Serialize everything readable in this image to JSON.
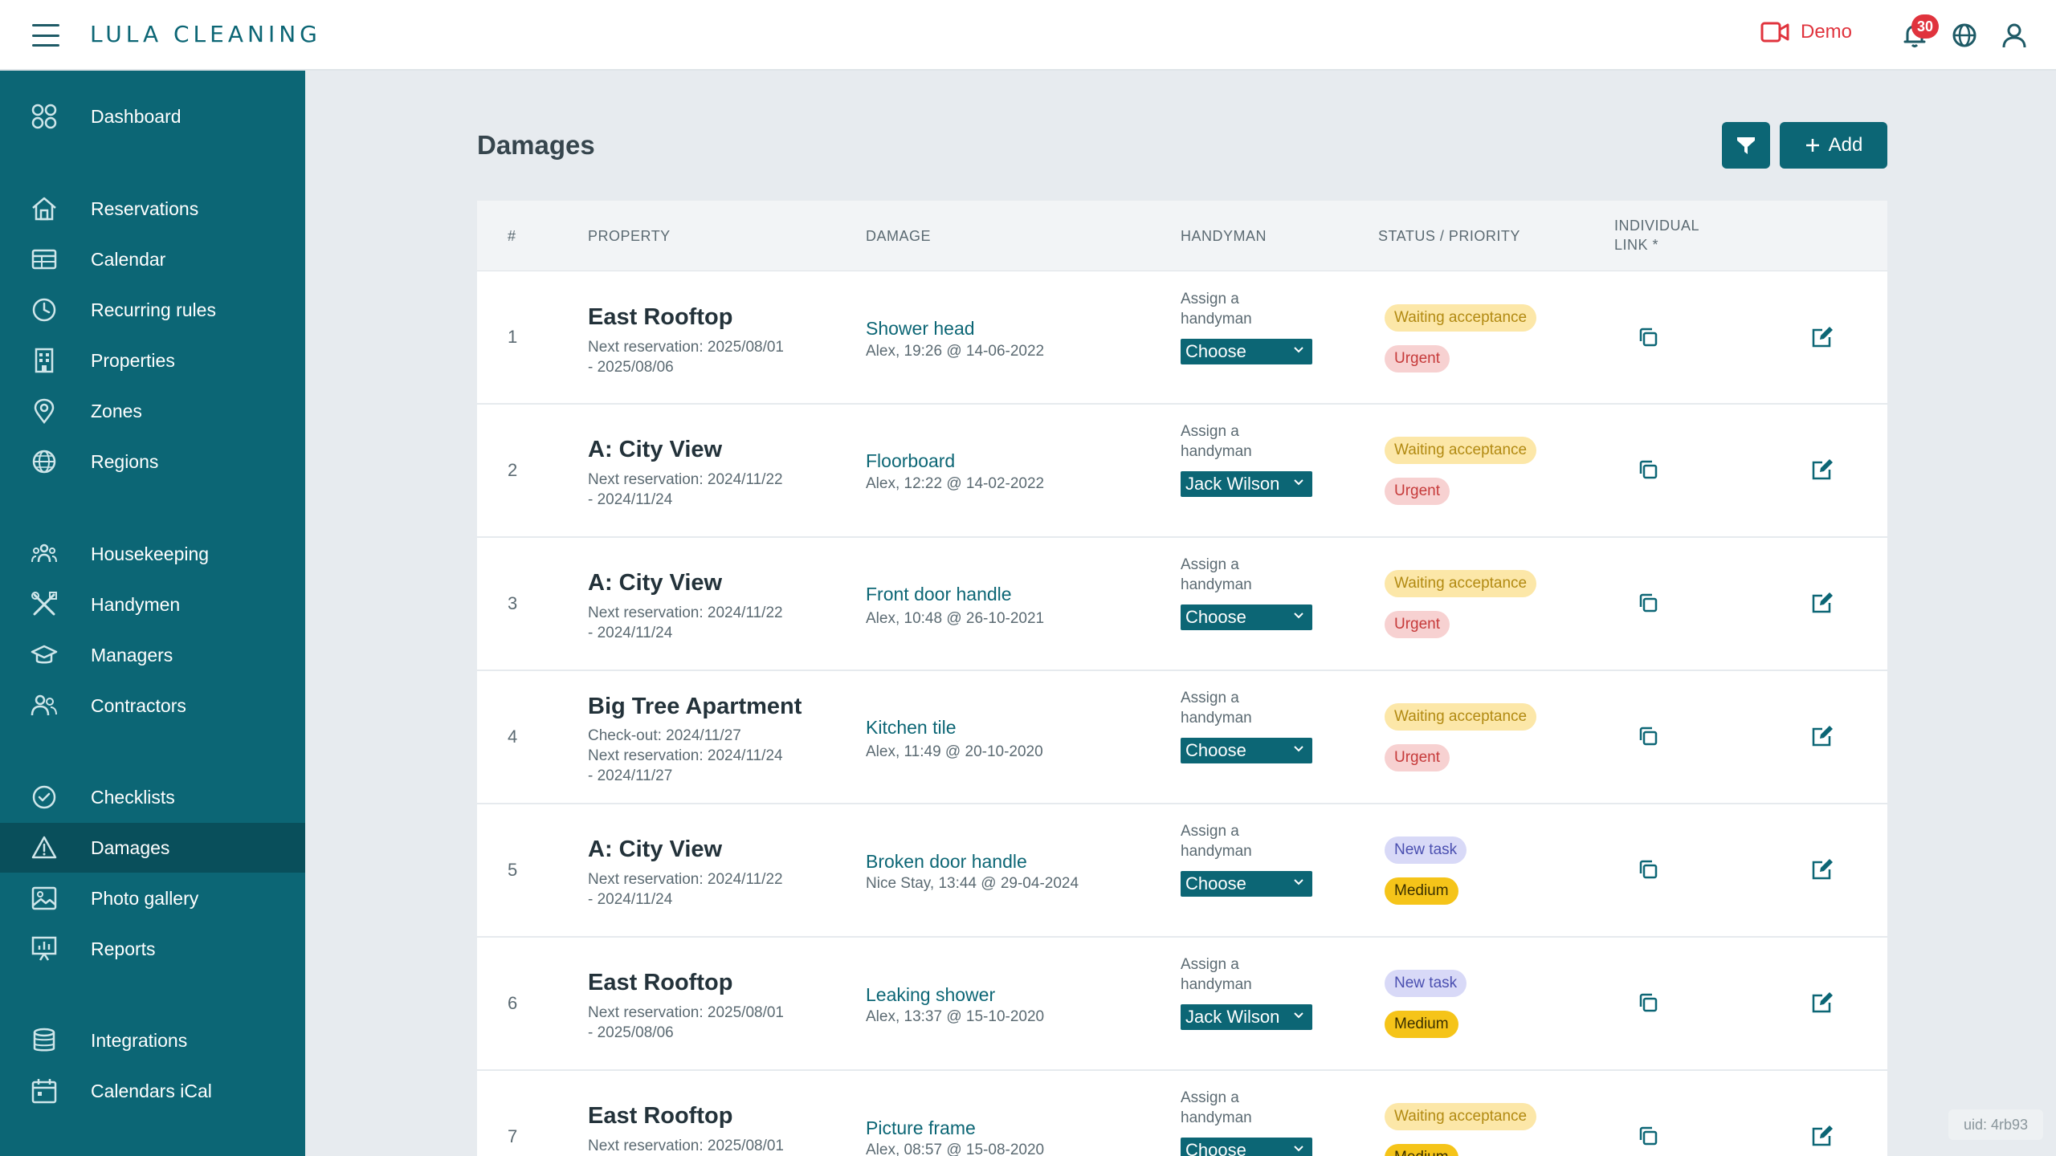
{
  "app": {
    "logo": "LULA CLEANING",
    "demo_label": "Demo",
    "notifications_count": "30",
    "uid": "uid: 4rb93"
  },
  "sidebar": {
    "items": [
      {
        "label": "Dashboard",
        "icon": "grid-icon"
      },
      {
        "label": "Reservations",
        "icon": "home-icon"
      },
      {
        "label": "Calendar",
        "icon": "calendar-table-icon"
      },
      {
        "label": "Recurring rules",
        "icon": "clock-icon"
      },
      {
        "label": "Properties",
        "icon": "building-icon"
      },
      {
        "label": "Zones",
        "icon": "map-pin-icon"
      },
      {
        "label": "Regions",
        "icon": "globe-icon"
      },
      {
        "label": "Housekeeping",
        "icon": "people-group-icon"
      },
      {
        "label": "Handymen",
        "icon": "tools-icon"
      },
      {
        "label": "Managers",
        "icon": "graduation-cap-icon"
      },
      {
        "label": "Contractors",
        "icon": "users-icon"
      },
      {
        "label": "Checklists",
        "icon": "check-circle-icon"
      },
      {
        "label": "Damages",
        "icon": "warning-triangle-icon",
        "active": true
      },
      {
        "label": "Photo gallery",
        "icon": "image-icon"
      },
      {
        "label": "Reports",
        "icon": "chart-board-icon"
      },
      {
        "label": "Integrations",
        "icon": "database-icon"
      },
      {
        "label": "Calendars iCal",
        "icon": "calendar-icon"
      }
    ]
  },
  "main": {
    "title": "Damages",
    "add_label": "Add",
    "columns": {
      "num": "#",
      "property": "PROPERTY",
      "damage": "DAMAGE",
      "handyman": "HANDYMAN",
      "status": "STATUS / PRIORITY",
      "link_line1": "INDIVIDUAL",
      "link_line2": "LINK *"
    },
    "rows": [
      {
        "num": "1",
        "property": "East Rooftop",
        "sub1": "Next reservation: 2025/08/01",
        "sub2": "- 2025/08/06",
        "sub3": "",
        "damage": "Shower head",
        "damage_sub": "Alex, 19:26 @ 14-06-2022",
        "assign1": "Assign a",
        "assign2": "handyman",
        "handyman": "Choose",
        "status": "Waiting acceptance",
        "priority": "Urgent"
      },
      {
        "num": "2",
        "property": "A: City View",
        "sub1": "Next reservation: 2024/11/22",
        "sub2": "- 2024/11/24",
        "sub3": "",
        "damage": "Floorboard",
        "damage_sub": "Alex, 12:22 @ 14-02-2022",
        "assign1": "Assign a",
        "assign2": "handyman",
        "handyman": "Jack Wilson",
        "status": "Waiting acceptance",
        "priority": "Urgent"
      },
      {
        "num": "3",
        "property": "A: City View",
        "sub1": "Next reservation: 2024/11/22",
        "sub2": "- 2024/11/24",
        "sub3": "",
        "damage": "Front door handle",
        "damage_sub": "Alex, 10:48 @ 26-10-2021",
        "assign1": "Assign a",
        "assign2": "handyman",
        "handyman": "Choose",
        "status": "Waiting acceptance",
        "priority": "Urgent"
      },
      {
        "num": "4",
        "property": "Big Tree Apartment",
        "sub1": "Check-out: 2024/11/27",
        "sub2": "Next reservation: 2024/11/24",
        "sub3": "- 2024/11/27",
        "damage": "Kitchen tile",
        "damage_sub": "Alex, 11:49 @ 20-10-2020",
        "assign1": "Assign a",
        "assign2": "handyman",
        "handyman": "Choose",
        "status": "Waiting acceptance",
        "priority": "Urgent"
      },
      {
        "num": "5",
        "property": "A: City View",
        "sub1": "Next reservation: 2024/11/22",
        "sub2": "- 2024/11/24",
        "sub3": "",
        "damage": "Broken door handle",
        "damage_sub": "Nice Stay, 13:44 @ 29-04-2024",
        "assign1": "Assign a",
        "assign2": "handyman",
        "handyman": "Choose",
        "status": "New task",
        "priority": "Medium"
      },
      {
        "num": "6",
        "property": "East Rooftop",
        "sub1": "Next reservation: 2025/08/01",
        "sub2": "- 2025/08/06",
        "sub3": "",
        "damage": "Leaking shower",
        "damage_sub": "Alex, 13:37 @ 15-10-2020",
        "assign1": "Assign a",
        "assign2": "handyman",
        "handyman": "Jack Wilson",
        "status": "New task",
        "priority": "Medium"
      },
      {
        "num": "7",
        "property": "East Rooftop",
        "sub1": "Next reservation: 2025/08/01",
        "sub2": "",
        "sub3": "",
        "damage": "Picture frame",
        "damage_sub": "Alex, 08:57 @ 15-08-2020",
        "assign1": "Assign a",
        "assign2": "handyman",
        "handyman": "Choose",
        "status": "Waiting acceptance",
        "priority": "Medium"
      }
    ]
  },
  "colors": {
    "primary": "#0c6675",
    "sidebar_active": "#094f5b",
    "demo_red": "#e0333d",
    "waiting_bg": "#fce7a8",
    "new_bg": "#d8d9f7",
    "urgent_bg": "#f7d1d1",
    "medium_bg": "#f5c419"
  }
}
